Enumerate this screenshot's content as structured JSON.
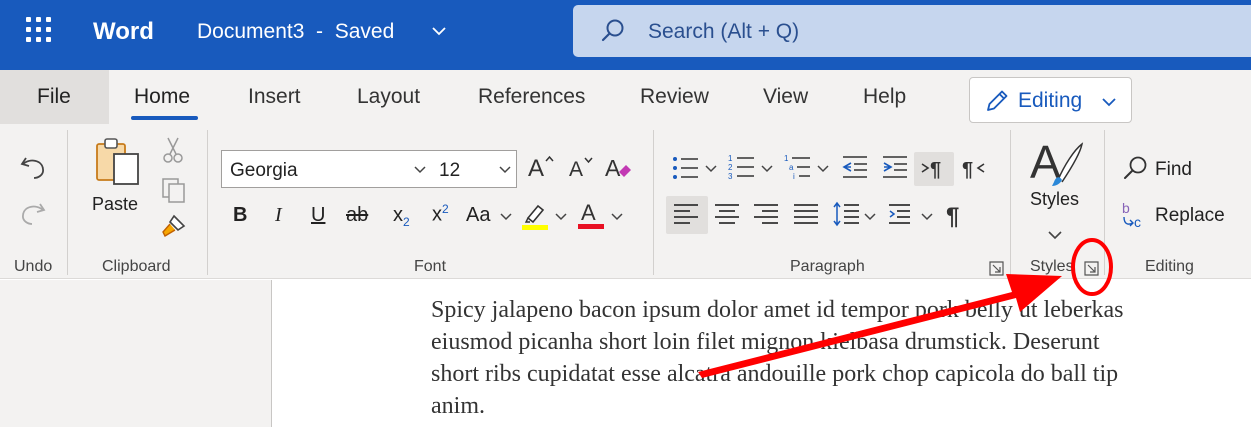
{
  "titlebar": {
    "app_name": "Word",
    "document_title": "Document3  -  Saved",
    "search_placeholder": "Search (Alt + Q)"
  },
  "tabs": [
    {
      "label": "File"
    },
    {
      "label": "Home",
      "selected": true
    },
    {
      "label": "Insert"
    },
    {
      "label": "Layout"
    },
    {
      "label": "References"
    },
    {
      "label": "Review"
    },
    {
      "label": "View"
    },
    {
      "label": "Help"
    }
  ],
  "mode_button": {
    "label": "Editing"
  },
  "ribbon": {
    "undo": {
      "group_label": "Undo"
    },
    "clipboard": {
      "group_label": "Clipboard",
      "paste_label": "Paste"
    },
    "font": {
      "group_label": "Font",
      "font_name": "Georgia",
      "font_size": "12",
      "change_case_label": "Aa",
      "highlight_color": "#ffff00",
      "font_color": "#e81123"
    },
    "paragraph": {
      "group_label": "Paragraph"
    },
    "styles": {
      "group_label": "Styles",
      "styles_label": "Styles"
    },
    "editing": {
      "group_label": "Editing",
      "find_label": "Find",
      "replace_label": "Replace"
    }
  },
  "document": {
    "lines": [
      "Spicy jalapeno bacon ipsum dolor amet id tempor pork belly ut leberkas",
      "eiusmod picanha short loin filet mignon kielbasa drumstick. Deserunt",
      "short ribs cupidatat esse alcatra andouille pork chop capicola do ball tip",
      "anim."
    ]
  },
  "colors": {
    "brand_blue": "#185abd",
    "annotation_red": "#ff0000"
  }
}
